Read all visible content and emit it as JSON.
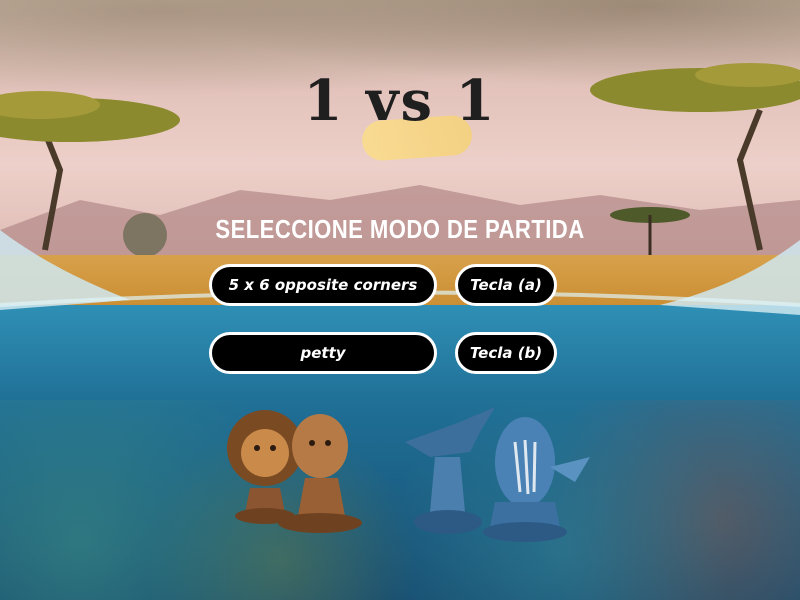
{
  "game": {
    "title": "1 vs 1",
    "heading": "SELECCIONE MODO DE PARTIDA",
    "modes": [
      {
        "label": "5 x 6 opposite corners",
        "key_hint": "Tecla (a)"
      },
      {
        "label": "petty",
        "key_hint": "Tecla (b)"
      }
    ]
  },
  "pieces": {
    "left_team": [
      "lion-piece-icon",
      "lioness-piece-icon"
    ],
    "right_team": [
      "shark-piece-icon",
      "whale-piece-icon"
    ]
  },
  "colors": {
    "button_bg": "#000000",
    "button_border": "#ffffff",
    "heading_text": "#ffffff",
    "title_text": "#1f1f1f"
  }
}
